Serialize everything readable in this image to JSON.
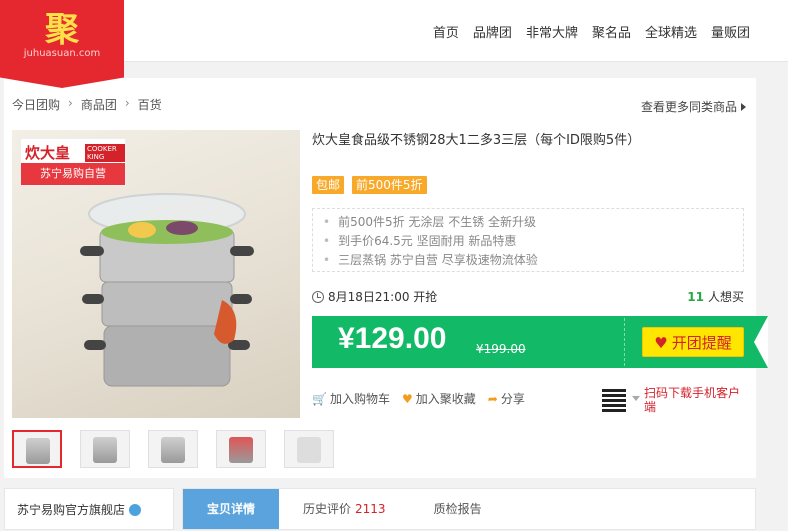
{
  "logo": {
    "mark": "聚",
    "domain": "juhuasuan.com"
  },
  "nav": [
    "首页",
    "品牌团",
    "非常大牌",
    "聚名品",
    "全球精选",
    "量贩团"
  ],
  "breadcrumb": [
    "今日团购",
    "商品团",
    "百货"
  ],
  "more_link": "查看更多同类商品",
  "product": {
    "brand_cn": "炊大皇",
    "brand_en": "COOKER KING",
    "brand_sub": "苏宁易购自营",
    "title": "炊大皇食品级不锈钢28大1二多3三层（每个ID限购5件）",
    "tags": [
      "包邮",
      "前500件5折"
    ],
    "features": [
      "前500件5折 无涂层 不生锈 全新升级",
      "到手价64.5元 坚固耐用 新品特惠",
      "三层蒸锅 苏宁自营 尽享极速物流体验"
    ],
    "start_time": "8月18日21:00 开抢",
    "want_count": "11",
    "want_label": "人想买",
    "price": "¥129.00",
    "original_price": "¥199.00",
    "remind_label": "开团提醒"
  },
  "actions": {
    "cart": "加入购物车",
    "favorite": "加入聚收藏",
    "share": "分享"
  },
  "qr_text": "扫码下载手机客户端",
  "store": {
    "name": "苏宁易购官方旗舰店"
  },
  "tabs": [
    {
      "label": "宝贝详情"
    },
    {
      "label": "历史评价",
      "count": "2113"
    },
    {
      "label": "质检报告"
    }
  ],
  "colors": {
    "brand_red": "#e5282f",
    "price_green": "#12b967",
    "tag_orange": "#f8a92a",
    "remind_yellow": "#ffe600"
  }
}
